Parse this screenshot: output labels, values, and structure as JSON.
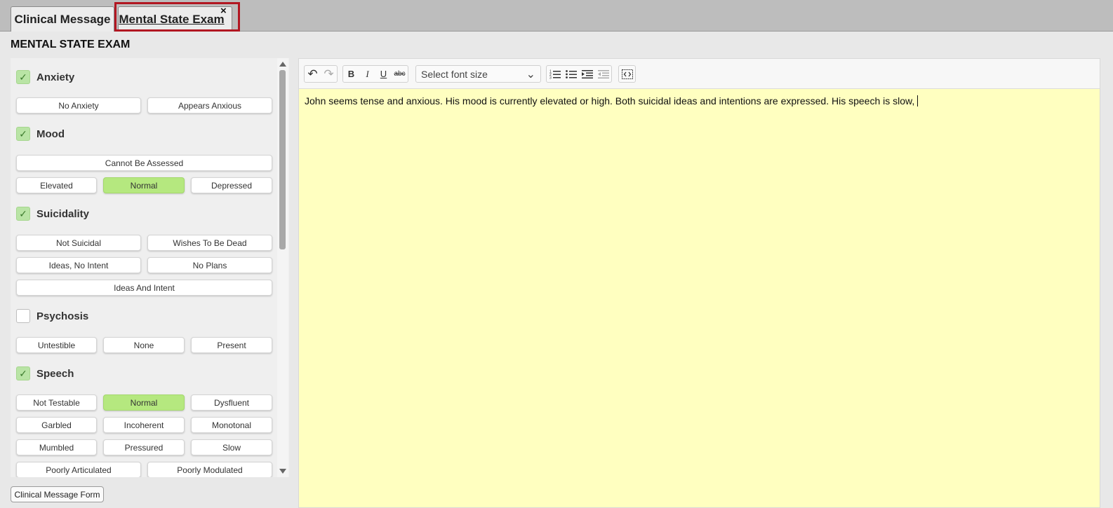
{
  "tabs": [
    {
      "label": "Clinical Message"
    },
    {
      "label": "Mental State Exam",
      "active": true,
      "close_symbol": "×"
    }
  ],
  "page_title": "MENTAL STATE EXAM",
  "sections": [
    {
      "label": "Anxiety",
      "checked": true,
      "options": [
        "No Anxiety",
        "Appears Anxious"
      ],
      "selected": []
    },
    {
      "label": "Mood",
      "checked": true,
      "options": [
        "Cannot Be Assessed",
        "Elevated",
        "Normal",
        "Depressed"
      ],
      "selected": [
        "Normal"
      ]
    },
    {
      "label": "Suicidality",
      "checked": true,
      "options": [
        "Not Suicidal",
        "Wishes To Be Dead",
        "Ideas, No Intent",
        "No Plans",
        "Ideas And Intent"
      ],
      "selected": []
    },
    {
      "label": "Psychosis",
      "checked": false,
      "options": [
        "Untestible",
        "None",
        "Present"
      ],
      "selected": []
    },
    {
      "label": "Speech",
      "checked": true,
      "options": [
        "Not Testable",
        "Normal",
        "Dysfluent",
        "Garbled",
        "Incoherent",
        "Monotonal",
        "Mumbled",
        "Pressured",
        "Slow",
        "Poorly Articulated",
        "Poorly Modulated"
      ],
      "selected": [
        "Normal"
      ]
    }
  ],
  "checkmark": "✓",
  "form_button": "Clinical Message Form",
  "toolbar": {
    "undo_icon": "↶",
    "redo_icon": "↷",
    "bold": "B",
    "italic": "I",
    "underline": "U",
    "strike": "abc",
    "font_size_placeholder": "Select font size",
    "chevron": "⌄"
  },
  "editor": {
    "text": "John seems tense and anxious. His mood is currently elevated or high. Both suicidal ideas and intentions are expressed. His speech is slow,",
    "background": "#ffffc0"
  },
  "colors": {
    "selected_option": "#b5e87f",
    "focus_outline": "#b21722",
    "checkbox_on": "#b9e4a5"
  }
}
